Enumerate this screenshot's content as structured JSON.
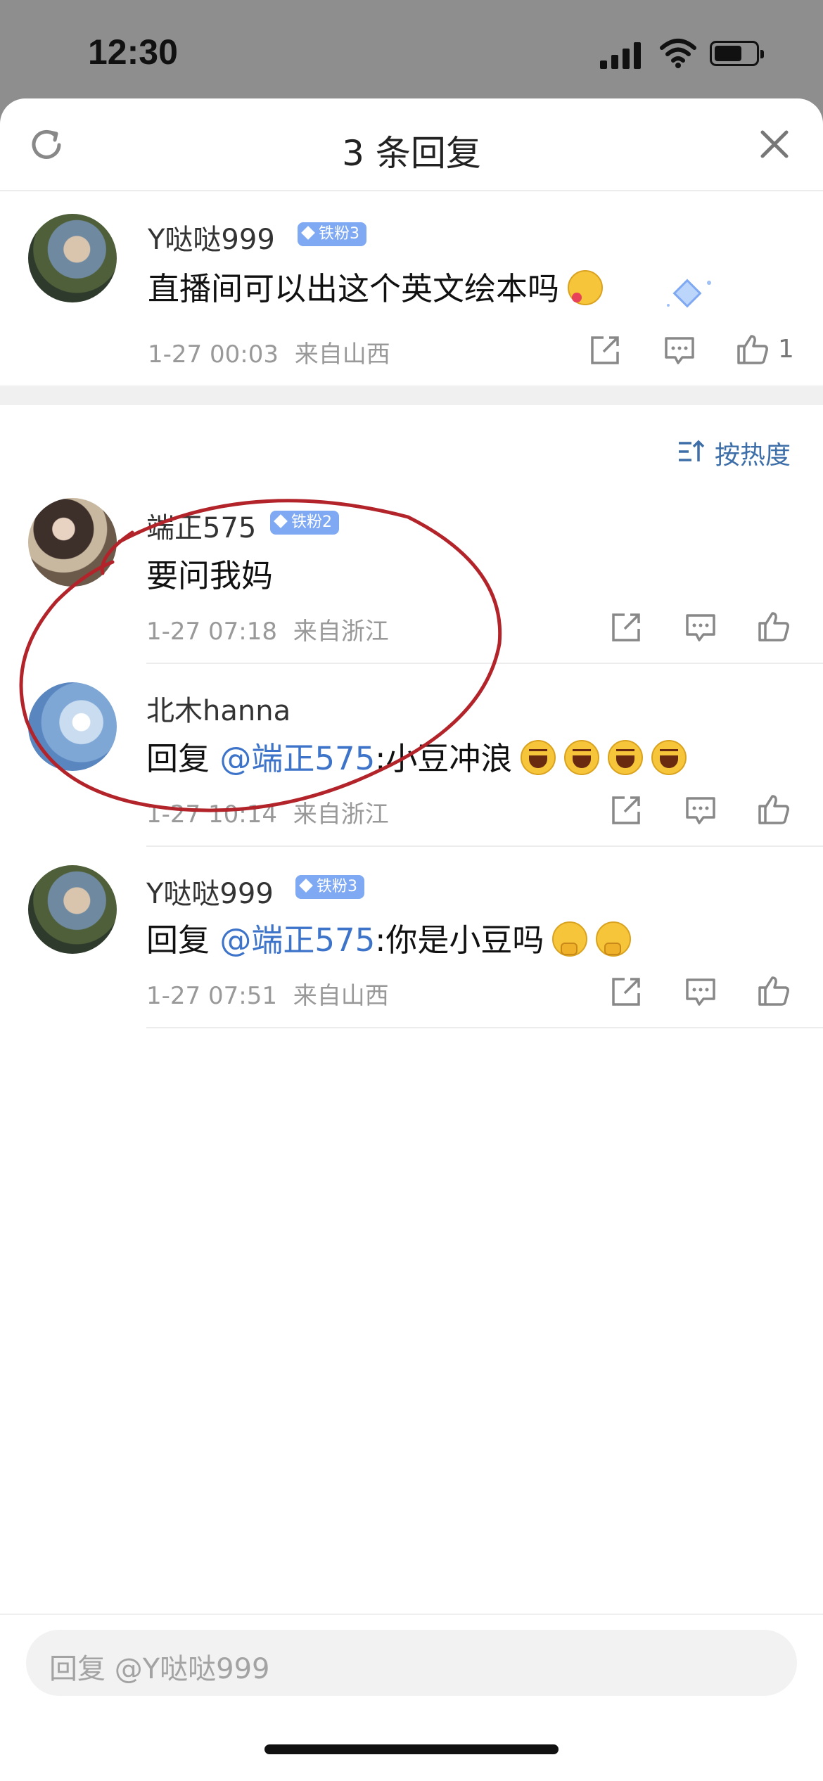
{
  "status_bar": {
    "time": "12:30"
  },
  "header": {
    "title": "3 条回复"
  },
  "root_comment": {
    "user": "Y哒哒999",
    "badge": "铁粉3",
    "text": "直播间可以出这个英文绘本吗",
    "time": "1-27 00:03",
    "location": "来自山西",
    "likes": "1"
  },
  "sort_label": "按热度",
  "replies": [
    {
      "user": "端正575",
      "badge": "铁粉2",
      "text": "要问我妈",
      "time": "1-27 07:18",
      "location": "来自浙江"
    },
    {
      "user": "北木hanna",
      "prefix": "回复 ",
      "mention": "@端正575",
      "text": ":小豆冲浪",
      "time": "1-27 10:14",
      "location": "来自浙江"
    },
    {
      "user": "Y哒哒999",
      "badge": "铁粉3",
      "prefix": "回复 ",
      "mention": "@端正575",
      "text": ":你是小豆吗",
      "time": "1-27 07:51",
      "location": "来自山西"
    }
  ],
  "footer": {
    "placeholder": "回复 @Y哒哒999"
  },
  "colors": {
    "mention": "#3d74c9",
    "badge": "#7fa9f2",
    "annotation": "#b2242a"
  }
}
